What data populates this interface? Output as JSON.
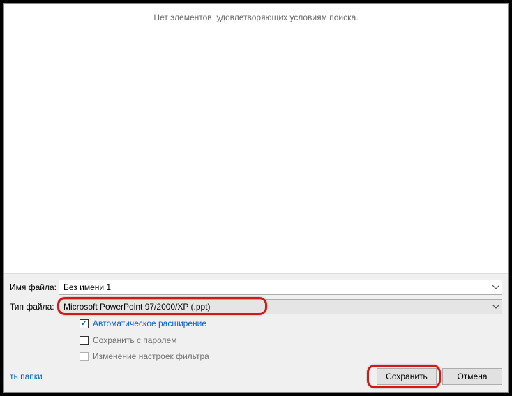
{
  "fileArea": {
    "emptyMessage": "Нет элементов, удовлетворяющих условиям поиска."
  },
  "fields": {
    "filenameLabel": "Имя файла:",
    "filenameValue": "Без имени 1",
    "filetypeLabel": "Тип файла:",
    "filetypeValue": "Microsoft PowerPoint 97/2000/XP (.ppt)"
  },
  "options": {
    "autoExtension": "Автоматическое расширение",
    "saveWithPassword": "Сохранить с паролем",
    "filterSettings": "Изменение настроек фильтра"
  },
  "footer": {
    "foldersLink": "ть папки",
    "saveLabel": "Сохранить",
    "cancelLabel": "Отмена"
  }
}
